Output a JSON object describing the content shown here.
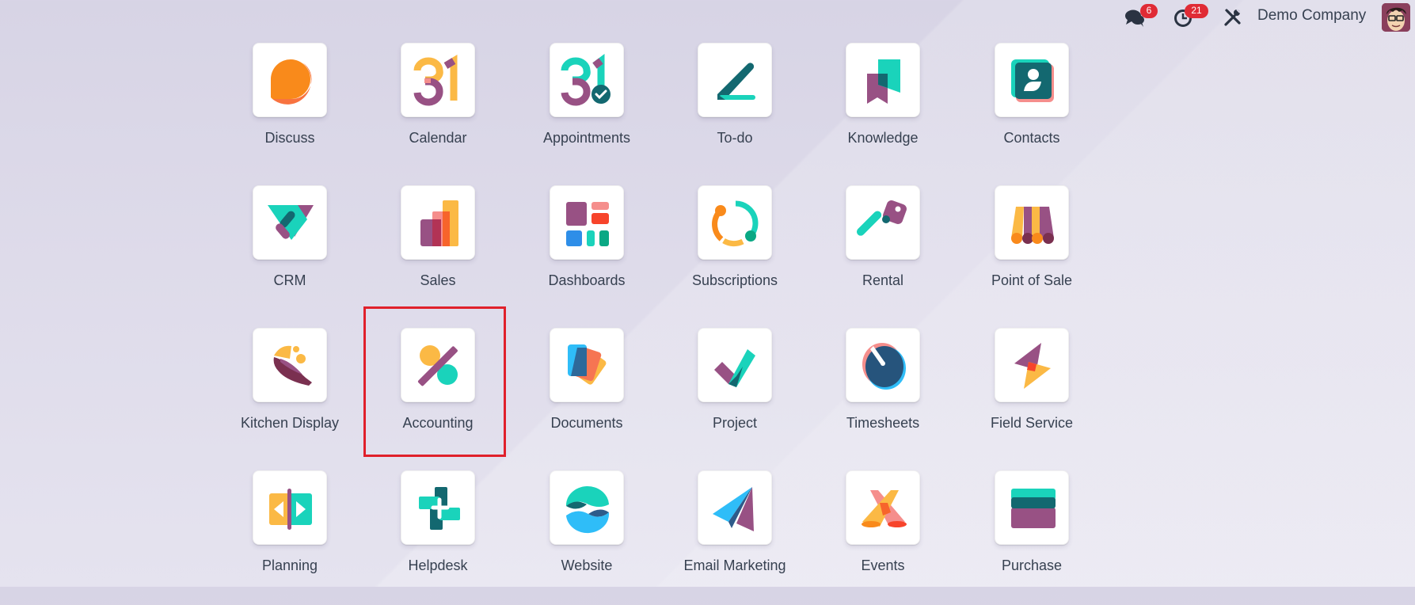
{
  "systray": {
    "messages_badge": "6",
    "activities_badge": "21",
    "company_name": "Demo Company",
    "icons": [
      "chat-icon",
      "clock-icon",
      "tools-icon",
      "avatar"
    ]
  },
  "apps": [
    {
      "label": "Discuss",
      "icon": "discuss-icon"
    },
    {
      "label": "Calendar",
      "icon": "calendar-icon"
    },
    {
      "label": "Appointments",
      "icon": "appointments-icon"
    },
    {
      "label": "To-do",
      "icon": "todo-icon"
    },
    {
      "label": "Knowledge",
      "icon": "knowledge-icon"
    },
    {
      "label": "Contacts",
      "icon": "contacts-icon"
    },
    {
      "label": "CRM",
      "icon": "crm-icon"
    },
    {
      "label": "Sales",
      "icon": "sales-icon"
    },
    {
      "label": "Dashboards",
      "icon": "dashboards-icon"
    },
    {
      "label": "Subscriptions",
      "icon": "subscriptions-icon"
    },
    {
      "label": "Rental",
      "icon": "rental-icon"
    },
    {
      "label": "Point of Sale",
      "icon": "point-of-sale-icon"
    },
    {
      "label": "Kitchen Display",
      "icon": "kitchen-display-icon"
    },
    {
      "label": "Accounting",
      "icon": "accounting-icon"
    },
    {
      "label": "Documents",
      "icon": "documents-icon"
    },
    {
      "label": "Project",
      "icon": "project-icon"
    },
    {
      "label": "Timesheets",
      "icon": "timesheets-icon"
    },
    {
      "label": "Field Service",
      "icon": "field-service-icon"
    },
    {
      "label": "Planning",
      "icon": "planning-icon"
    },
    {
      "label": "Helpdesk",
      "icon": "helpdesk-icon"
    },
    {
      "label": "Website",
      "icon": "website-icon"
    },
    {
      "label": "Email Marketing",
      "icon": "email-marketing-icon"
    },
    {
      "label": "Events",
      "icon": "events-icon"
    },
    {
      "label": "Purchase",
      "icon": "purchase-icon"
    }
  ],
  "highlighted_app": "Accounting",
  "colors": {
    "badge": "#e02b35",
    "highlight_border": "#e0202b",
    "text": "#374151"
  }
}
